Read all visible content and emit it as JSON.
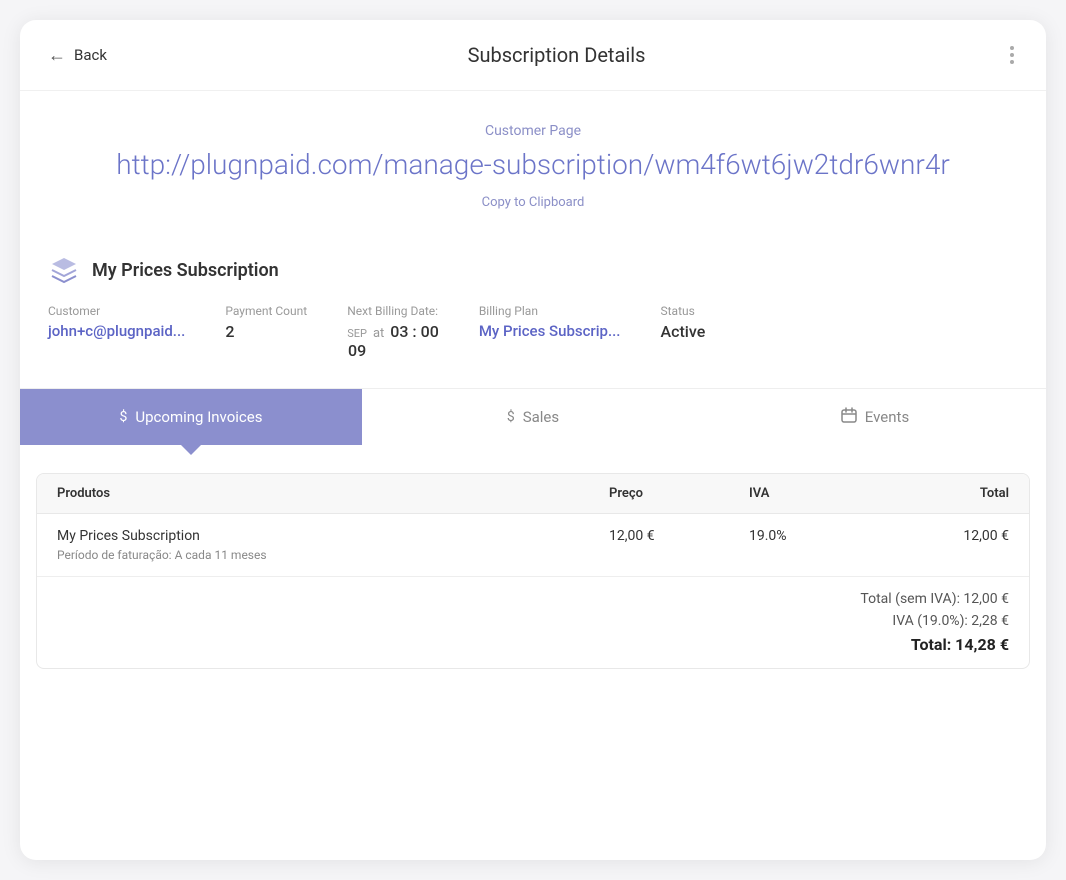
{
  "header": {
    "back_label": "Back",
    "title": "Subscription Details",
    "more_label": "more"
  },
  "customer_page": {
    "label": "Customer Page",
    "url": "http://plugnpaid.com/manage-subscription/wm4f6wt6jw2tdr6wnr4r",
    "copy_label": "Copy to Clipboard"
  },
  "subscription": {
    "title": "My Prices Subscription",
    "fields": {
      "customer_label": "Customer",
      "customer_value": "john+c@plugnpaid...",
      "payment_count_label": "Payment Count",
      "payment_count_value": "2",
      "next_billing_label": "Next Billing Date:",
      "billing_month": "SEP",
      "billing_day": "09",
      "at_label": "at",
      "billing_time": "03 : 00",
      "billing_plan_label": "Billing Plan",
      "billing_plan_value": "My Prices Subscrip...",
      "status_label": "Status",
      "status_value": "Active"
    }
  },
  "tabs": [
    {
      "id": "upcoming",
      "icon": "$",
      "label": "Upcoming Invoices",
      "active": true
    },
    {
      "id": "sales",
      "icon": "$",
      "label": "Sales",
      "active": false
    },
    {
      "id": "events",
      "icon": "📅",
      "label": "Events",
      "active": false
    }
  ],
  "table": {
    "headers": {
      "produtos": "Produtos",
      "preco": "Preço",
      "iva": "IVA",
      "total": "Total"
    },
    "rows": [
      {
        "product": "My Prices Subscription",
        "period": "Período de faturação: A cada 11 meses",
        "preco": "12,00 €",
        "iva": "19.0%",
        "total": "12,00 €"
      }
    ],
    "totals": {
      "sem_iva_label": "Total (sem IVA): 12,00 €",
      "iva_label": "IVA (19.0%): 2,28 €",
      "total_label": "Total: 14,28 €"
    }
  }
}
